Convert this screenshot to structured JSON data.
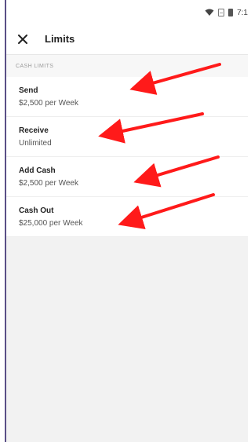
{
  "statusbar": {
    "time": "7:1"
  },
  "appbar": {
    "title": "Limits"
  },
  "section": {
    "header": "CASH LIMITS",
    "rows": [
      {
        "label": "Send",
        "value": "$2,500 per Week"
      },
      {
        "label": "Receive",
        "value": "Unlimited"
      },
      {
        "label": "Add Cash",
        "value": "$2,500 per Week"
      },
      {
        "label": "Cash Out",
        "value": "$25,000 per Week"
      }
    ]
  },
  "colors": {
    "arrow": "#ff1a1a",
    "left_border": "#5a4f86",
    "background": "#f2f2f2"
  }
}
